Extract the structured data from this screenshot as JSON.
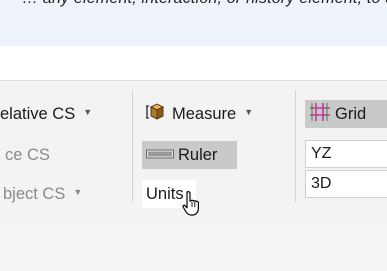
{
  "banner": {
    "text": "… any element, interaction, or history element, to display …"
  },
  "ribbon": {
    "column1": {
      "relative_cs": "elative CS",
      "surface_cs": "ce CS",
      "object_cs": "bject CS"
    },
    "column2": {
      "measure": "Measure",
      "ruler": "Ruler",
      "units": "Units"
    },
    "column3": {
      "grid": "Grid",
      "yz": "YZ",
      "threed": "3D"
    }
  },
  "icons": {
    "measure": "measure-box-icon",
    "ruler": "ruler-icon",
    "grid": "grid-icon",
    "caret": "chevron-down-icon",
    "cursor": "mouse-pointer-icon"
  },
  "colors": {
    "grid_icon": "#c0399a",
    "highlight": "#c9c9c9",
    "banner_bg": "#eef3fb"
  }
}
